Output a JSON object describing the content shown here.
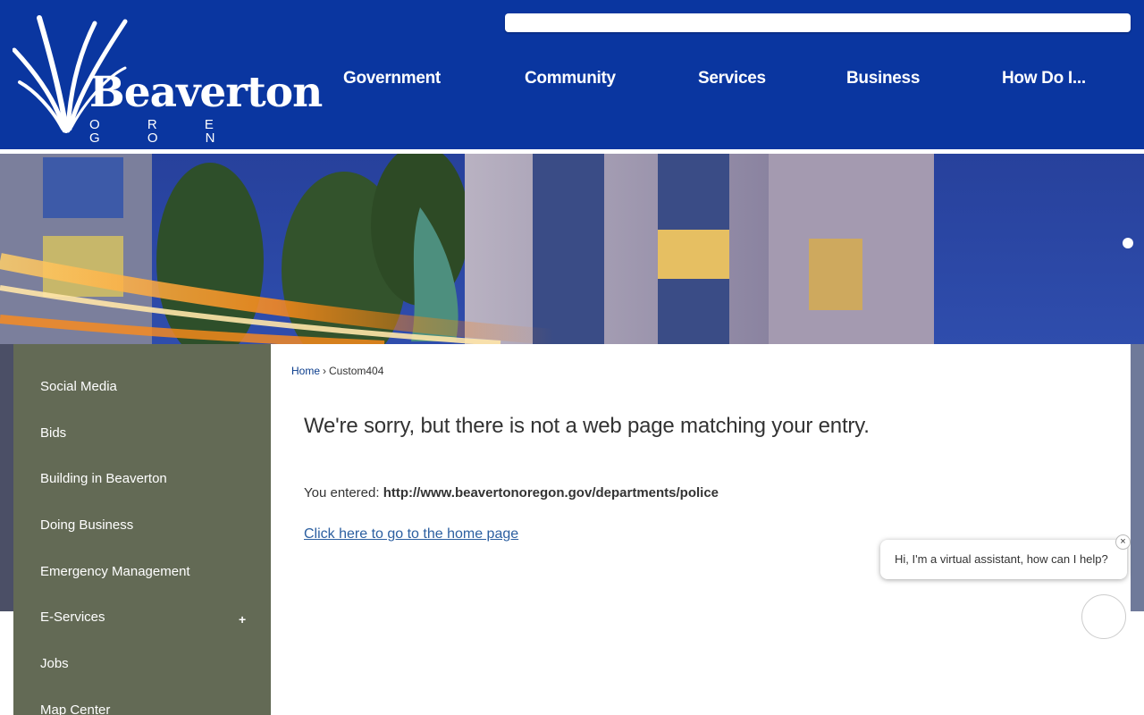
{
  "header": {
    "logo": {
      "name": "Beaverton",
      "sub": "O R E G O N"
    },
    "search": {
      "value": "",
      "placeholder": ""
    },
    "nav": [
      "Government",
      "Community",
      "Services",
      "Business",
      "How Do I..."
    ]
  },
  "sidebar": {
    "items": [
      {
        "label": "Social Media"
      },
      {
        "label": "Bids"
      },
      {
        "label": "Building in Beaverton"
      },
      {
        "label": "Doing Business"
      },
      {
        "label": "Emergency Management"
      },
      {
        "label": "E-Services",
        "expand": "+"
      },
      {
        "label": "Jobs"
      },
      {
        "label": "Map Center"
      }
    ]
  },
  "breadcrumb": {
    "home": "Home",
    "separator": "›",
    "current": "Custom404"
  },
  "main": {
    "title": "We're sorry, but there is not a web page matching your entry.",
    "entered_label": "You entered:",
    "entered_url": "http://www.beavertonoregon.gov/departments/police",
    "home_link": "Click here to go to the home page"
  },
  "assistant": {
    "message": "Hi, I'm a virtual assistant, how can I help?",
    "close": "×"
  },
  "colors": {
    "header_blue": "#0a36a0",
    "sidebar_green": "#636a55",
    "link_blue": "#2c5fa0"
  },
  "icons": {
    "logo": "reed-grass-logo",
    "close": "close-icon",
    "chat": "chat-launcher-icon"
  }
}
